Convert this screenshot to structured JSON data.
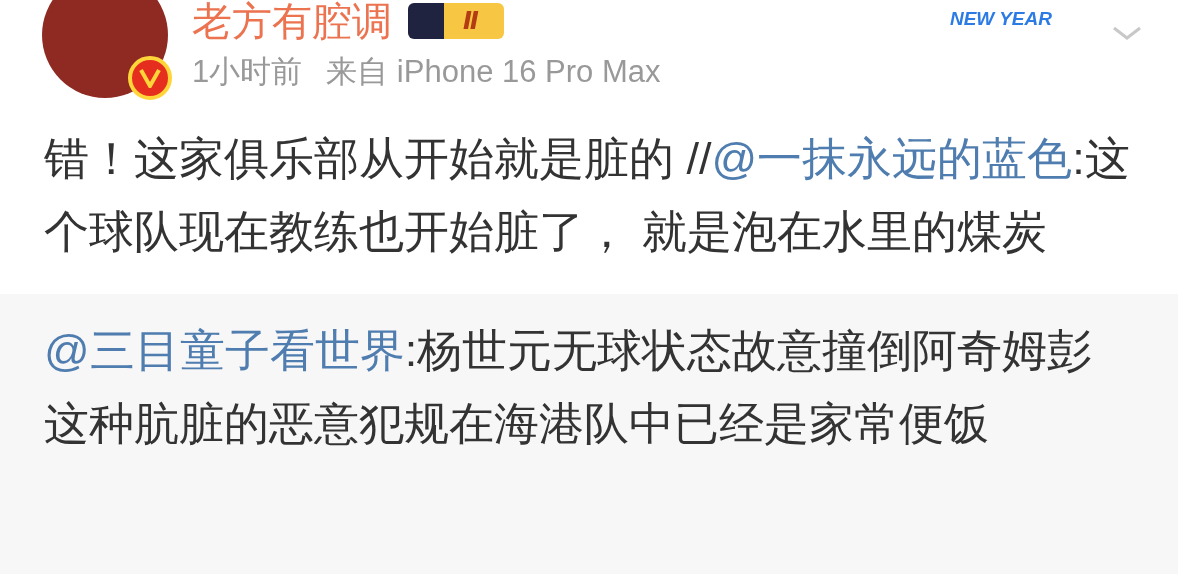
{
  "post": {
    "author": "老方有腔调",
    "level_badge": "Ⅱ",
    "time": "1小时前",
    "source": "来自 iPhone 16 Pro Max",
    "decoration_text": "NEW YEAR",
    "segments": [
      {
        "kind": "text",
        "text": "错！这家俱乐部从开始就是脏的 //"
      },
      {
        "kind": "mention",
        "text": "@一抹永远的蓝色"
      },
      {
        "kind": "text",
        "text": ":这个球队现在教练也开始脏了， 就是泡在水里的煤炭"
      }
    ]
  },
  "retweet": {
    "segments": [
      {
        "kind": "mention",
        "text": "@三目童子看世界"
      },
      {
        "kind": "text",
        "text": ":杨世元无球状态故意撞倒阿奇姆彭这种肮脏的恶意犯规在海港队中已经是家常便饭"
      }
    ]
  }
}
